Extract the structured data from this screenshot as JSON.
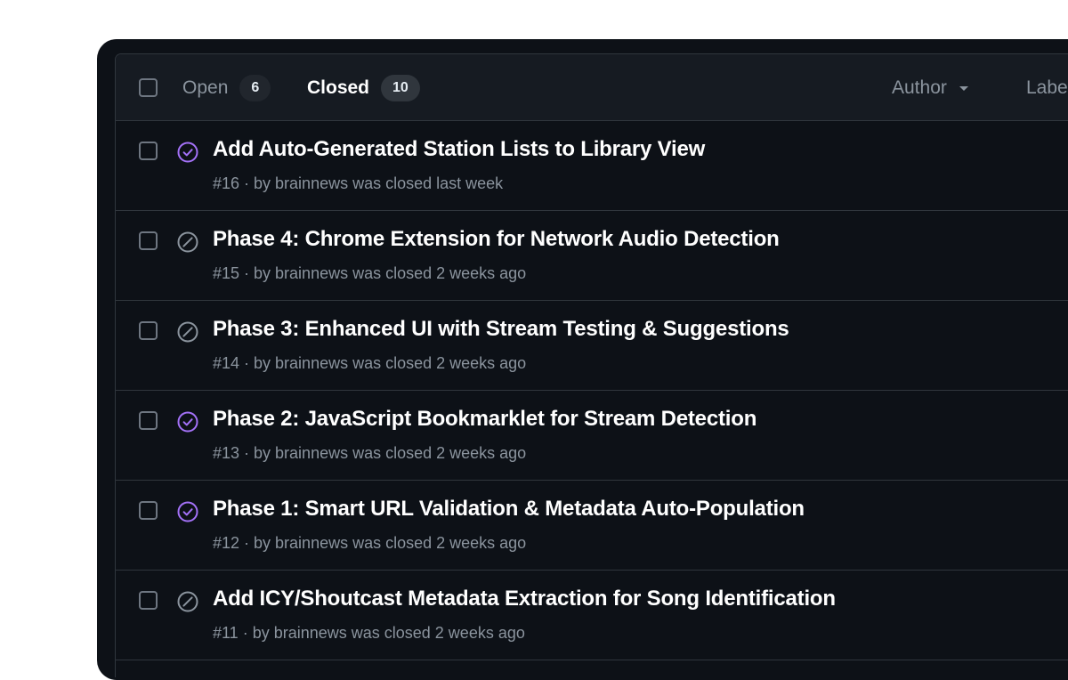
{
  "header": {
    "open_label": "Open",
    "open_count": "6",
    "closed_label": "Closed",
    "closed_count": "10",
    "author_label": "Author",
    "labels_label": "Labels"
  },
  "colors": {
    "completed": "#a371f7",
    "not_planned": "#8b949e"
  },
  "issues": [
    {
      "title": "Add Auto-Generated Station Lists to Library View",
      "meta": "#16 · by brainnews was closed last week",
      "status": "completed"
    },
    {
      "title": "Phase 4: Chrome Extension for Network Audio Detection",
      "meta": "#15 · by brainnews was closed 2 weeks ago",
      "status": "not-planned"
    },
    {
      "title": "Phase 3: Enhanced UI with Stream Testing & Suggestions",
      "meta": "#14 · by brainnews was closed 2 weeks ago",
      "status": "not-planned"
    },
    {
      "title": "Phase 2: JavaScript Bookmarklet for Stream Detection",
      "meta": "#13 · by brainnews was closed 2 weeks ago",
      "status": "completed"
    },
    {
      "title": "Phase 1: Smart URL Validation & Metadata Auto-Population",
      "meta": "#12 · by brainnews was closed 2 weeks ago",
      "status": "completed"
    },
    {
      "title": "Add ICY/Shoutcast Metadata Extraction for Song Identification",
      "meta": "#11 · by brainnews was closed 2 weeks ago",
      "status": "not-planned"
    }
  ]
}
